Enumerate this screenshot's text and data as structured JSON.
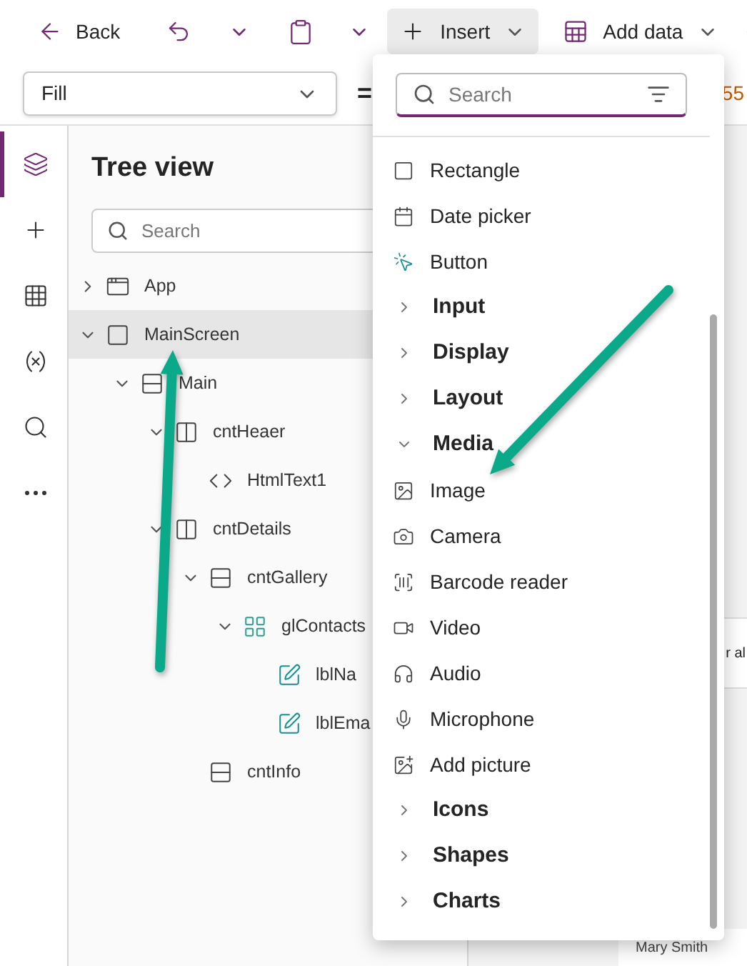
{
  "toolbar": {
    "back": "Back",
    "insert": {
      "label": "Insert",
      "expanded": true
    },
    "add_data": "Add data"
  },
  "formula_bar": {
    "property": "Fill",
    "equals": "=",
    "value": "55"
  },
  "rail": [
    {
      "kind": "layers",
      "selected": true
    },
    {
      "kind": "insert",
      "selected": false
    },
    {
      "kind": "data",
      "selected": false
    },
    {
      "kind": "variables",
      "selected": false
    },
    {
      "kind": "search",
      "selected": false
    },
    {
      "kind": "more",
      "selected": false
    }
  ],
  "tree_view": {
    "title": "Tree view",
    "search": {
      "placeholder": "Search"
    },
    "items": [
      {
        "label": "App",
        "kind": "app",
        "expanded": false,
        "selected": false
      },
      {
        "label": "MainScreen",
        "kind": "screen",
        "expanded": true,
        "selected": true,
        "children": [
          {
            "label": "Main",
            "kind": "stack",
            "expanded": true,
            "selected": false,
            "children": [
              {
                "label": "cntHeaer",
                "kind": "container",
                "expanded": true,
                "selected": false,
                "children": [
                  {
                    "label": "HtmlText1",
                    "kind": "html",
                    "selected": false
                  }
                ]
              },
              {
                "label": "cntDetails",
                "kind": "container",
                "expanded": true,
                "selected": false,
                "children": [
                  {
                    "label": "cntGallery",
                    "kind": "stack",
                    "expanded": true,
                    "selected": false,
                    "children": [
                      {
                        "label": "glContacts",
                        "kind": "gallery",
                        "expanded": true,
                        "selected": false,
                        "children": [
                          {
                            "label": "lblNa",
                            "kind": "label",
                            "selected": false
                          },
                          {
                            "label": "lblEma",
                            "kind": "label",
                            "selected": false
                          }
                        ]
                      }
                    ]
                  },
                  {
                    "label": "cntInfo",
                    "kind": "stack",
                    "selected": false
                  }
                ]
              }
            ]
          }
        ]
      }
    ]
  },
  "insert_menu": {
    "search": {
      "placeholder": "Search"
    },
    "items": [
      {
        "kind": "rectangle",
        "label": "Rectangle"
      },
      {
        "kind": "date_picker",
        "label": "Date picker"
      },
      {
        "kind": "button",
        "label": "Button"
      },
      {
        "kind": "group",
        "label": "Input",
        "expanded": false
      },
      {
        "kind": "group",
        "label": "Display",
        "expanded": false
      },
      {
        "kind": "group",
        "label": "Layout",
        "expanded": false
      },
      {
        "kind": "group",
        "label": "Media",
        "expanded": true
      },
      {
        "kind": "image",
        "label": "Image"
      },
      {
        "kind": "camera",
        "label": "Camera"
      },
      {
        "kind": "barcode",
        "label": "Barcode reader"
      },
      {
        "kind": "video",
        "label": "Video"
      },
      {
        "kind": "audio",
        "label": "Audio"
      },
      {
        "kind": "microphone",
        "label": "Microphone"
      },
      {
        "kind": "add_picture",
        "label": "Add picture"
      },
      {
        "kind": "group",
        "label": "Icons",
        "expanded": false
      },
      {
        "kind": "group",
        "label": "Shapes",
        "expanded": false
      },
      {
        "kind": "group",
        "label": "Charts",
        "expanded": false
      }
    ]
  },
  "canvas": {
    "card_text": "r al",
    "gallery_item": "Mary Smith"
  }
}
